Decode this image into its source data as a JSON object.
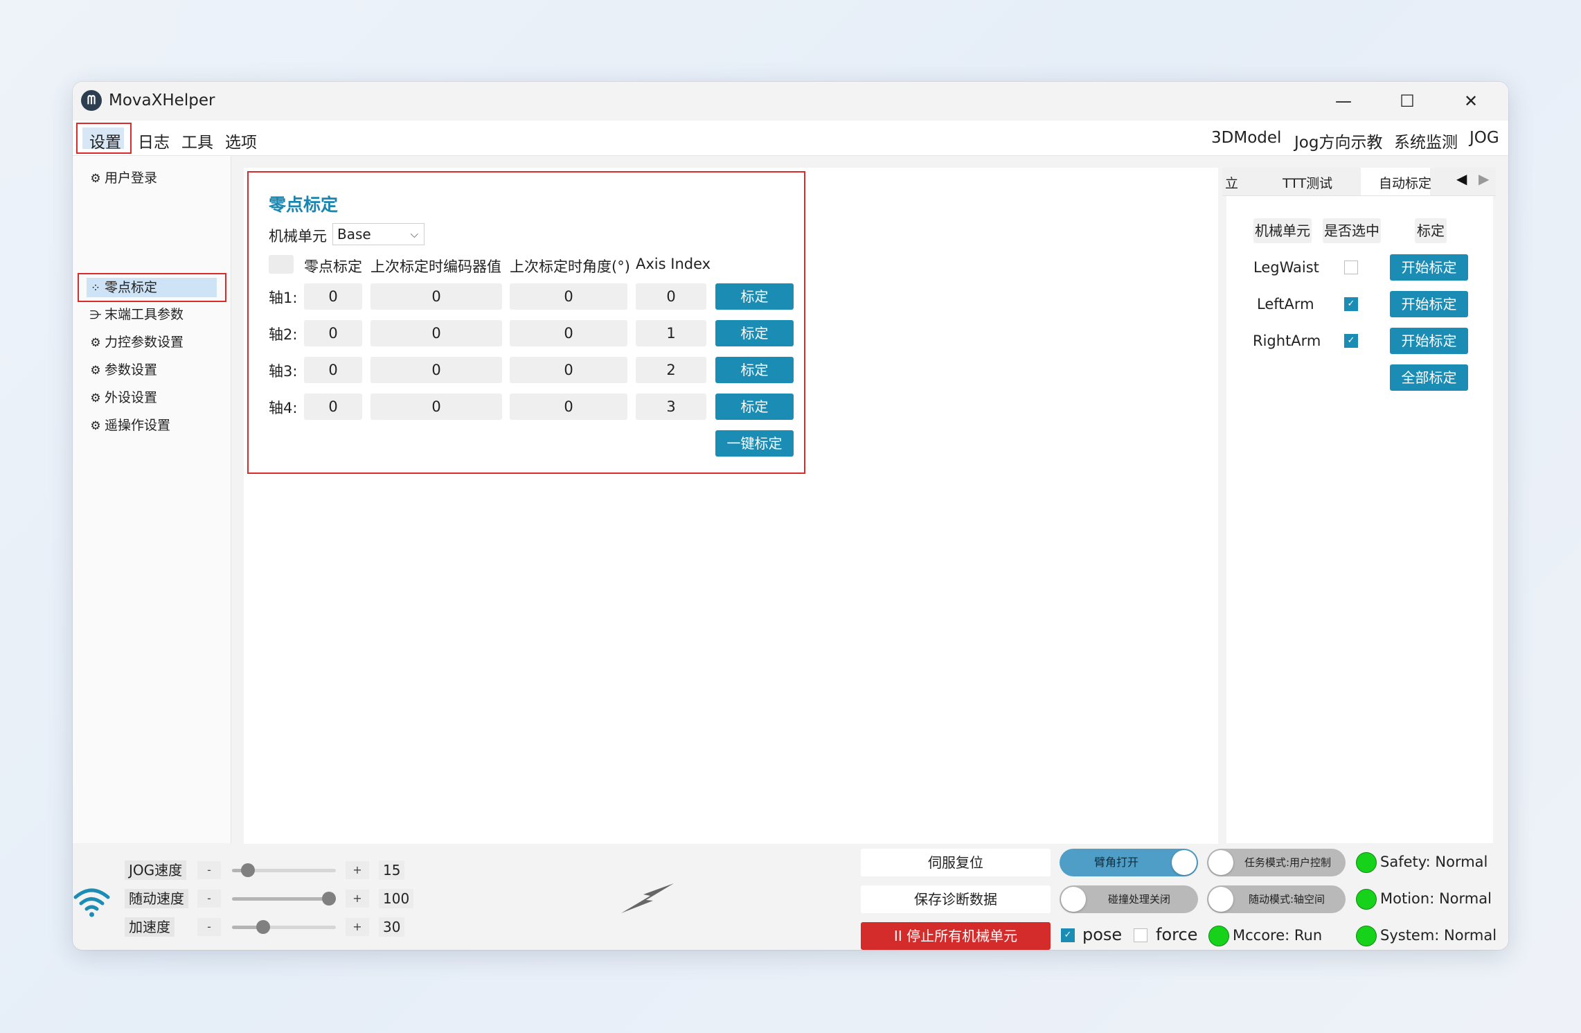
{
  "window": {
    "title": "MovaXHelper"
  },
  "menu": {
    "left": [
      "设置",
      "日志",
      "工具",
      "选项"
    ],
    "right": [
      "3DModel",
      "Jog方向示教",
      "系统监测",
      "JOG"
    ]
  },
  "sidebar": {
    "items": [
      {
        "label": "用户登录",
        "icon": "gear-icon"
      },
      {
        "label": "零点标定",
        "icon": "nodes-icon"
      },
      {
        "label": "末端工具参数",
        "icon": "tool-icon"
      },
      {
        "label": "力控参数设置",
        "icon": "gear-icon"
      },
      {
        "label": "参数设置",
        "icon": "gear-icon"
      },
      {
        "label": "外设设置",
        "icon": "gear-icon"
      },
      {
        "label": "遥操作设置",
        "icon": "gear-icon"
      }
    ],
    "active_index": 1
  },
  "calib": {
    "title": "零点标定",
    "unit_label": "机械单元",
    "unit_value": "Base",
    "headers": [
      "零点标定",
      "上次标定时编码器值",
      "上次标定时角度(°)",
      "Axis Index"
    ],
    "rows": [
      {
        "label": "轴1:",
        "zero": "0",
        "encoder": "0",
        "angle": "0",
        "index": "0",
        "button": "标定"
      },
      {
        "label": "轴2:",
        "zero": "0",
        "encoder": "0",
        "angle": "0",
        "index": "1",
        "button": "标定"
      },
      {
        "label": "轴3:",
        "zero": "0",
        "encoder": "0",
        "angle": "0",
        "index": "2",
        "button": "标定"
      },
      {
        "label": "轴4:",
        "zero": "0",
        "encoder": "0",
        "angle": "0",
        "index": "3",
        "button": "标定"
      }
    ],
    "one_key_button": "一键标定"
  },
  "right_panel": {
    "tabs": [
      "立",
      "TTT测试",
      "自动标定"
    ],
    "active_tab": "自动标定",
    "headers": [
      "机械单元",
      "是否选中",
      "标定"
    ],
    "rows": [
      {
        "unit": "LegWaist",
        "checked": false,
        "button": "开始标定"
      },
      {
        "unit": "LeftArm",
        "checked": true,
        "button": "开始标定"
      },
      {
        "unit": "RightArm",
        "checked": true,
        "button": "开始标定"
      }
    ],
    "all_button": "全部标定"
  },
  "bottom": {
    "speeds": [
      {
        "label": "JOG速度",
        "value": "15",
        "fraction": 0.15
      },
      {
        "label": "随动速度",
        "value": "100",
        "fraction": 1.0
      },
      {
        "label": "加速度",
        "value": "30",
        "fraction": 0.3
      }
    ],
    "minus": "-",
    "plus": "+",
    "buttons": {
      "servo_reset": "伺服复位",
      "save_diag": "保存诊断数据",
      "stop_all": "停止所有机械单元",
      "stop_icon": "II"
    },
    "toggles": [
      {
        "label": "臂角打开",
        "on": true
      },
      {
        "label": "任务模式:用户控制",
        "on": false
      },
      {
        "label": "碰撞处理关闭",
        "on": false
      },
      {
        "label": "随动模式:轴空间",
        "on": false
      }
    ],
    "checks": [
      {
        "label": "pose",
        "checked": true
      },
      {
        "label": "force",
        "checked": false
      }
    ],
    "status": [
      {
        "text": "Safety: Normal",
        "color": "#17d21b"
      },
      {
        "text": "Motion: Normal",
        "color": "#17d21b"
      },
      {
        "text": "Mccore: Run",
        "color": "#17d21b"
      },
      {
        "text": "System: Normal",
        "color": "#17d21b"
      }
    ]
  },
  "colors": {
    "accent": "#1b8db5",
    "highlight_box": "#d92b2b",
    "stop": "#d42b2b",
    "status_ok": "#17d21b"
  }
}
